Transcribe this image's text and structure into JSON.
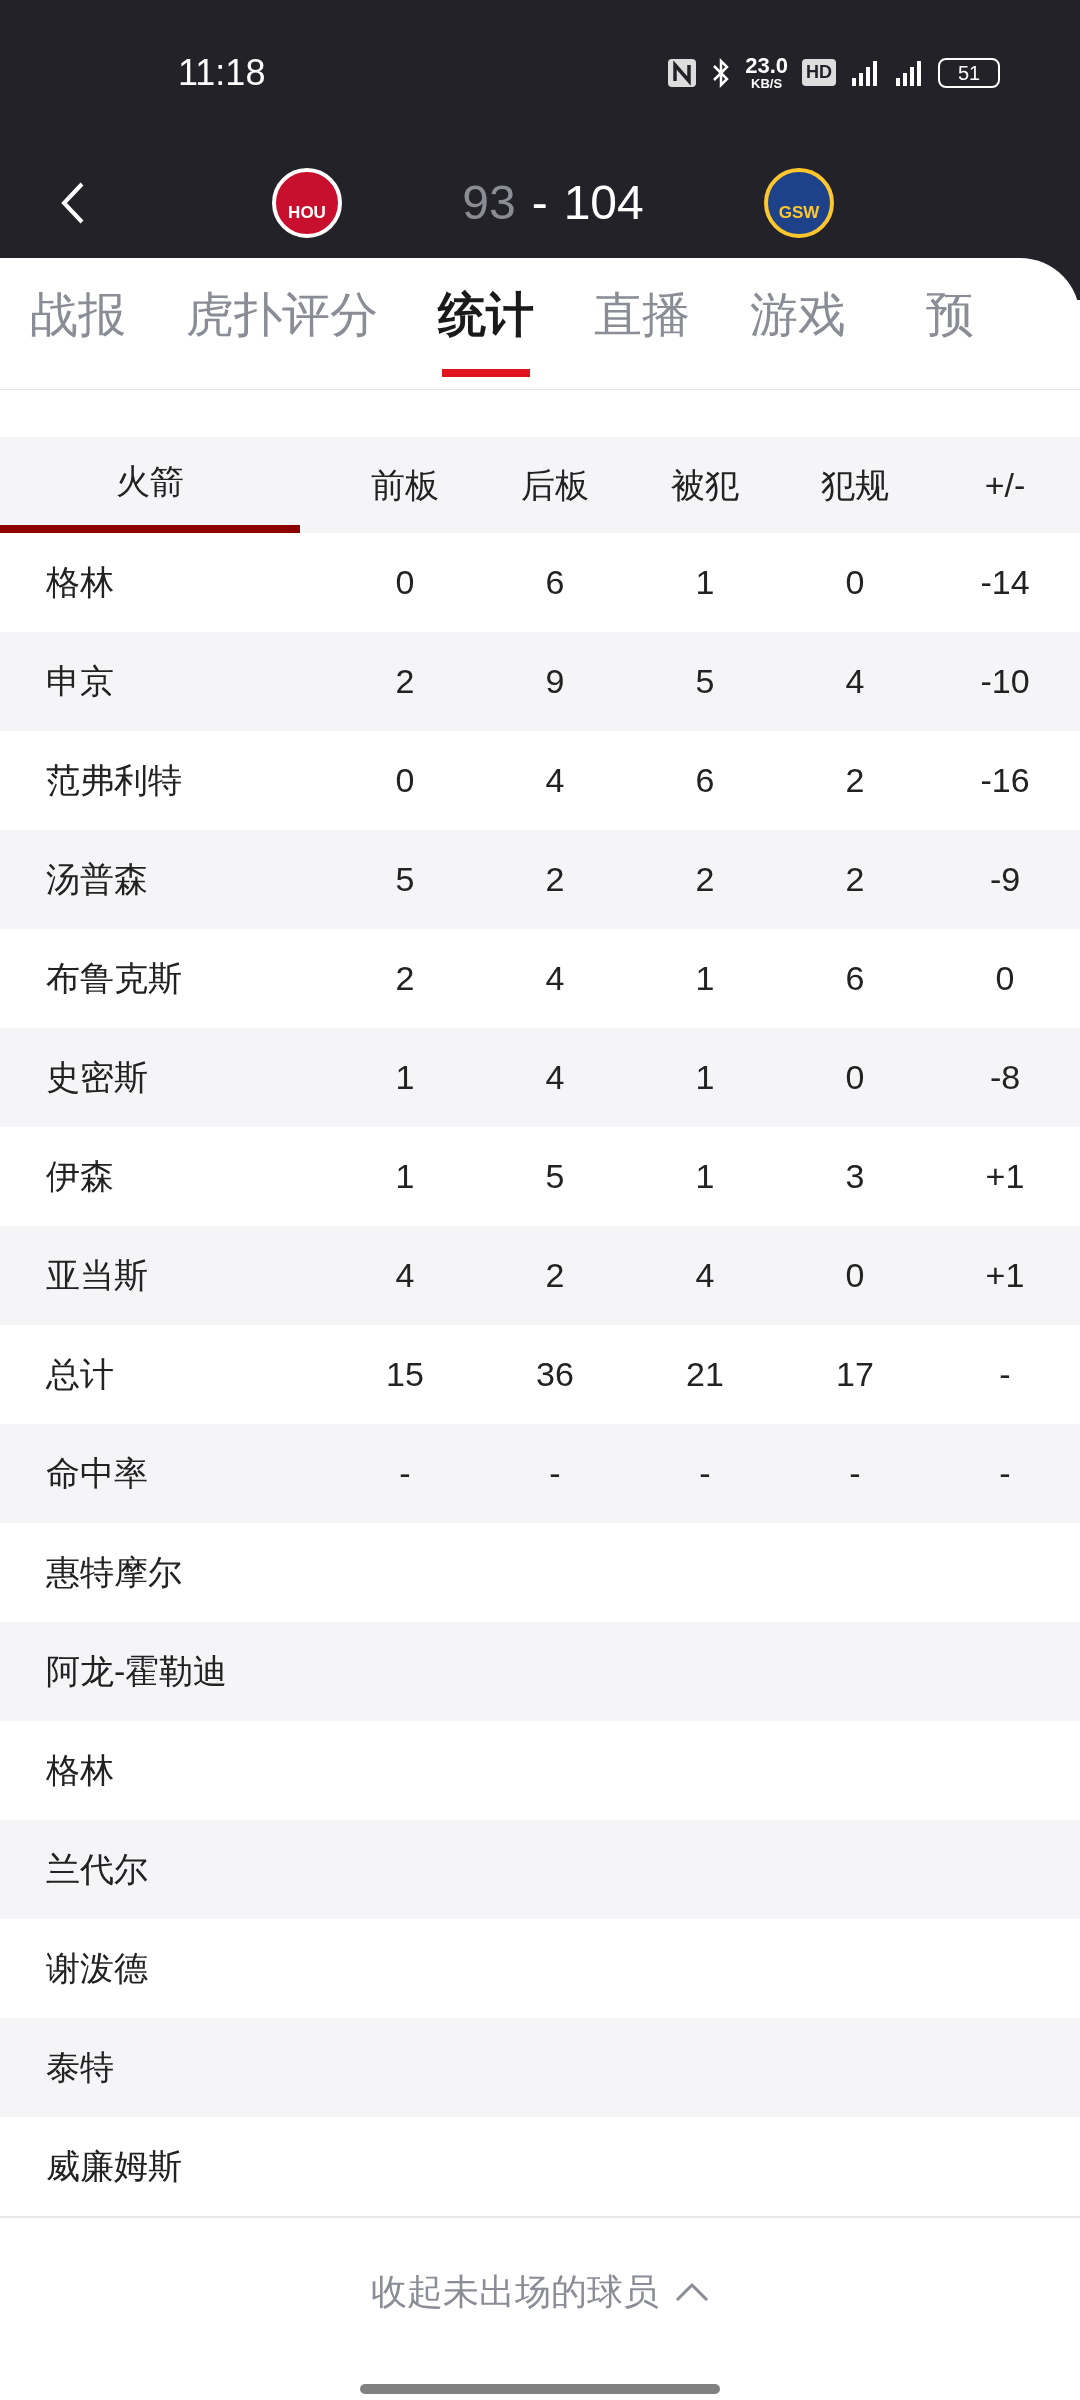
{
  "status_bar": {
    "time": "11:18",
    "speed": "23.0",
    "speed_unit": "KB/S",
    "hd": "HD",
    "battery": "51"
  },
  "header": {
    "home": {
      "abbr": "HOU",
      "score": "93"
    },
    "separator": "-",
    "away": {
      "abbr": "GSW",
      "score": "104"
    }
  },
  "tabs": [
    {
      "label": "战报",
      "selected": false
    },
    {
      "label": "虎扑评分",
      "selected": false
    },
    {
      "label": "统计",
      "selected": true
    },
    {
      "label": "直播",
      "selected": false
    },
    {
      "label": "游戏",
      "selected": false
    },
    {
      "label": "预",
      "selected": false
    }
  ],
  "table": {
    "team": {
      "label": "火箭",
      "selected": true
    },
    "columns": [
      "前板",
      "后板",
      "被犯",
      "犯规",
      "+/-"
    ],
    "rows": [
      {
        "name": "格林",
        "cells": [
          "0",
          "6",
          "1",
          "0",
          "-14"
        ]
      },
      {
        "name": "申京",
        "cells": [
          "2",
          "9",
          "5",
          "4",
          "-10"
        ]
      },
      {
        "name": "范弗利特",
        "cells": [
          "0",
          "4",
          "6",
          "2",
          "-16"
        ]
      },
      {
        "name": "汤普森",
        "cells": [
          "5",
          "2",
          "2",
          "2",
          "-9"
        ]
      },
      {
        "name": "布鲁克斯",
        "cells": [
          "2",
          "4",
          "1",
          "6",
          "0"
        ]
      },
      {
        "name": "史密斯",
        "cells": [
          "1",
          "4",
          "1",
          "0",
          "-8"
        ]
      },
      {
        "name": "伊森",
        "cells": [
          "1",
          "5",
          "1",
          "3",
          "+1"
        ]
      },
      {
        "name": "亚当斯",
        "cells": [
          "4",
          "2",
          "4",
          "0",
          "+1"
        ]
      },
      {
        "name": "总计",
        "cells": [
          "15",
          "36",
          "21",
          "17",
          "-"
        ]
      },
      {
        "name": "命中率",
        "cells": [
          "-",
          "-",
          "-",
          "-",
          "-"
        ]
      },
      {
        "name": "惠特摩尔",
        "cells": []
      },
      {
        "name": "阿龙-霍勒迪",
        "cells": []
      },
      {
        "name": "格林",
        "cells": []
      },
      {
        "name": "兰代尔",
        "cells": []
      },
      {
        "name": "谢泼德",
        "cells": []
      },
      {
        "name": "泰特",
        "cells": []
      },
      {
        "name": "威廉姆斯",
        "cells": []
      }
    ]
  },
  "footer": {
    "label": "收起未出场的球员"
  }
}
